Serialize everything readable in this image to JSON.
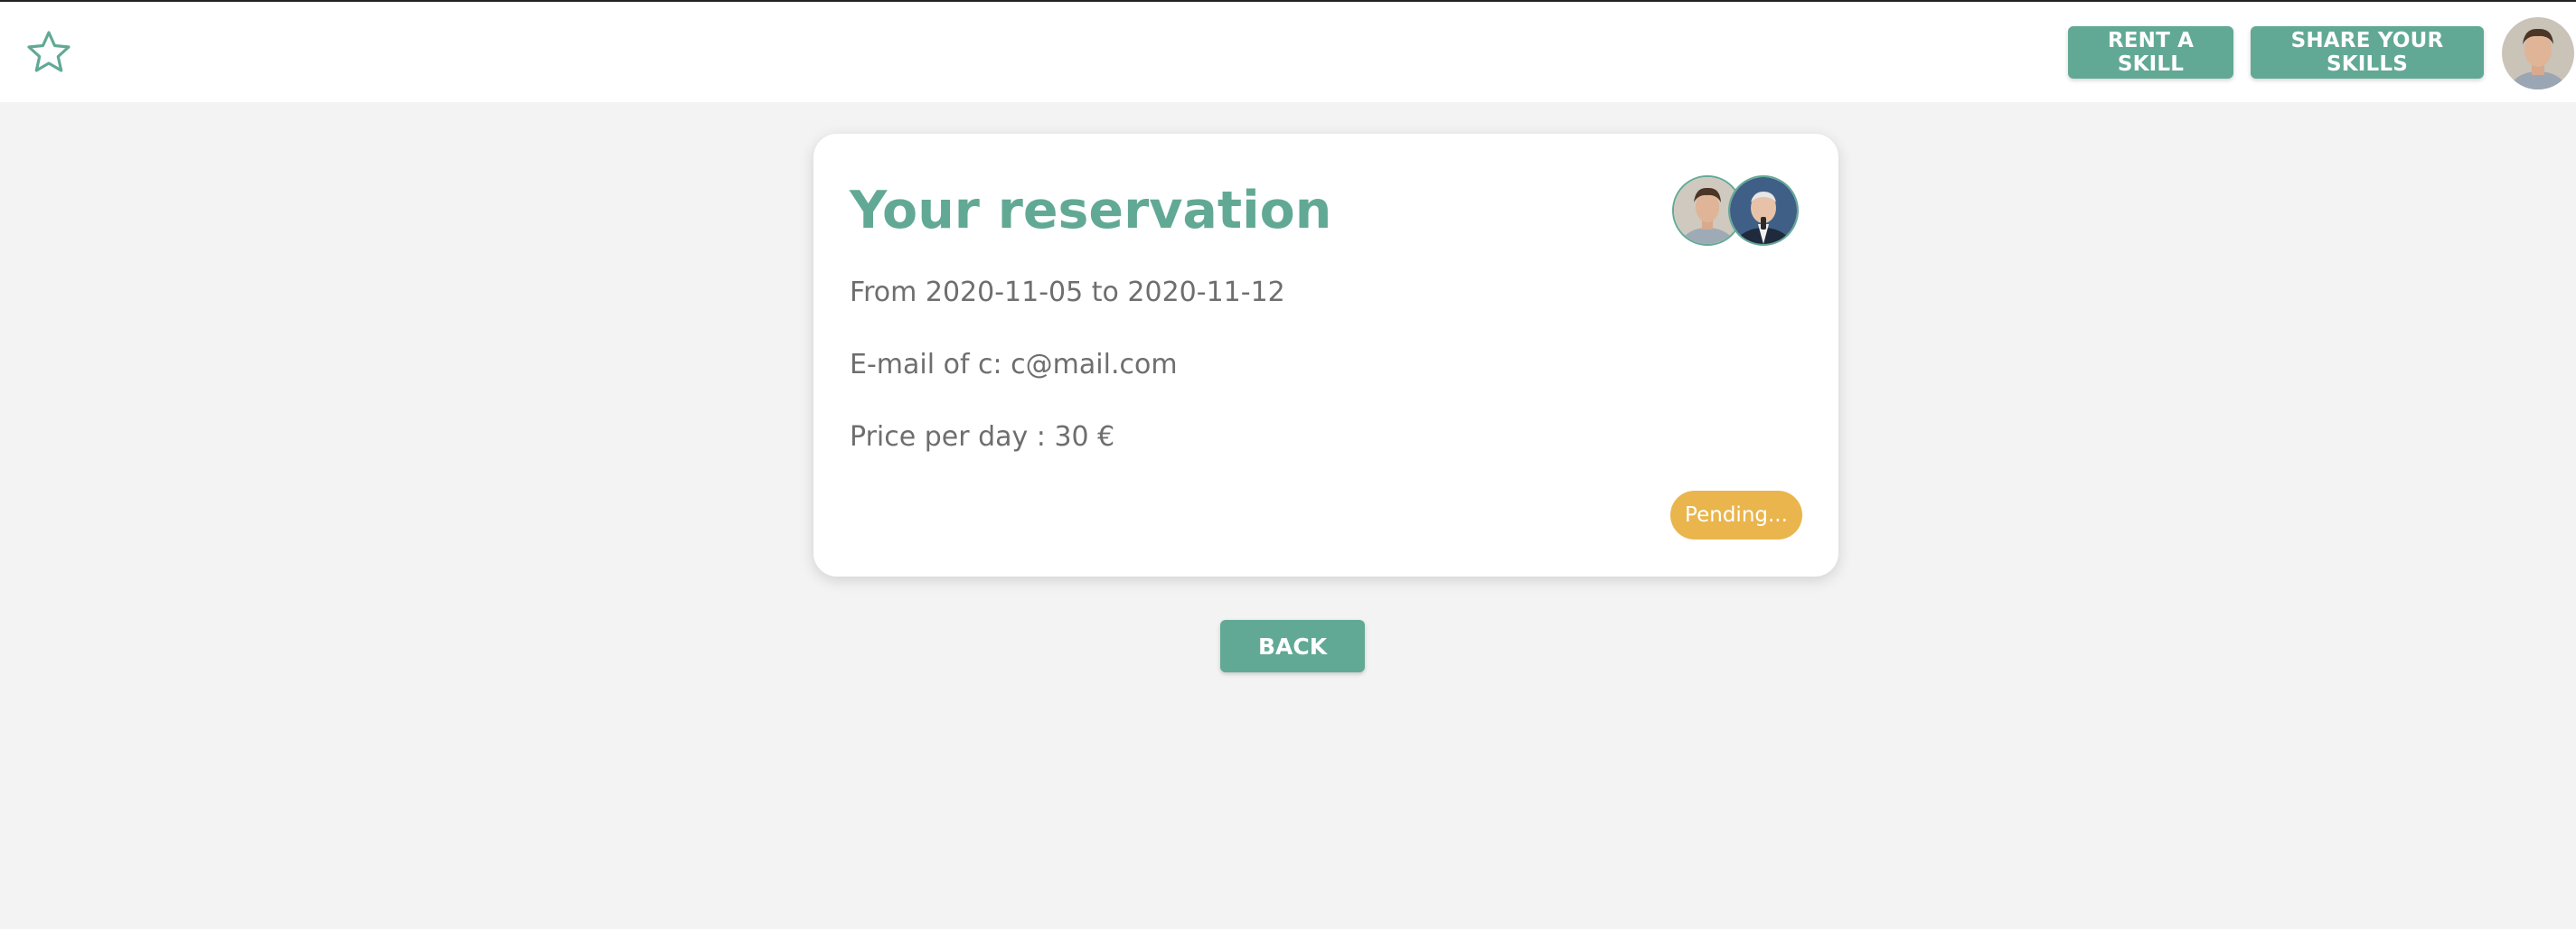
{
  "navbar": {
    "logo_icon": "star-outline-icon",
    "rent_label": "RENT A SKILL",
    "share_label": "SHARE YOUR SKILLS",
    "avatar_icon": "user-avatar"
  },
  "reservation": {
    "title": "Your reservation",
    "dates_text": "From 2020-11-05 to 2020-11-12",
    "email_text": "E-mail of c: c@mail.com",
    "price_text": "Price per day : 30 €",
    "status_label": "Pending..."
  },
  "actions": {
    "back_label": "BACK"
  },
  "colors": {
    "accent": "#62a995",
    "pending": "#e9b54c",
    "background": "#f3f3f3",
    "text": "#6e6e6e"
  }
}
